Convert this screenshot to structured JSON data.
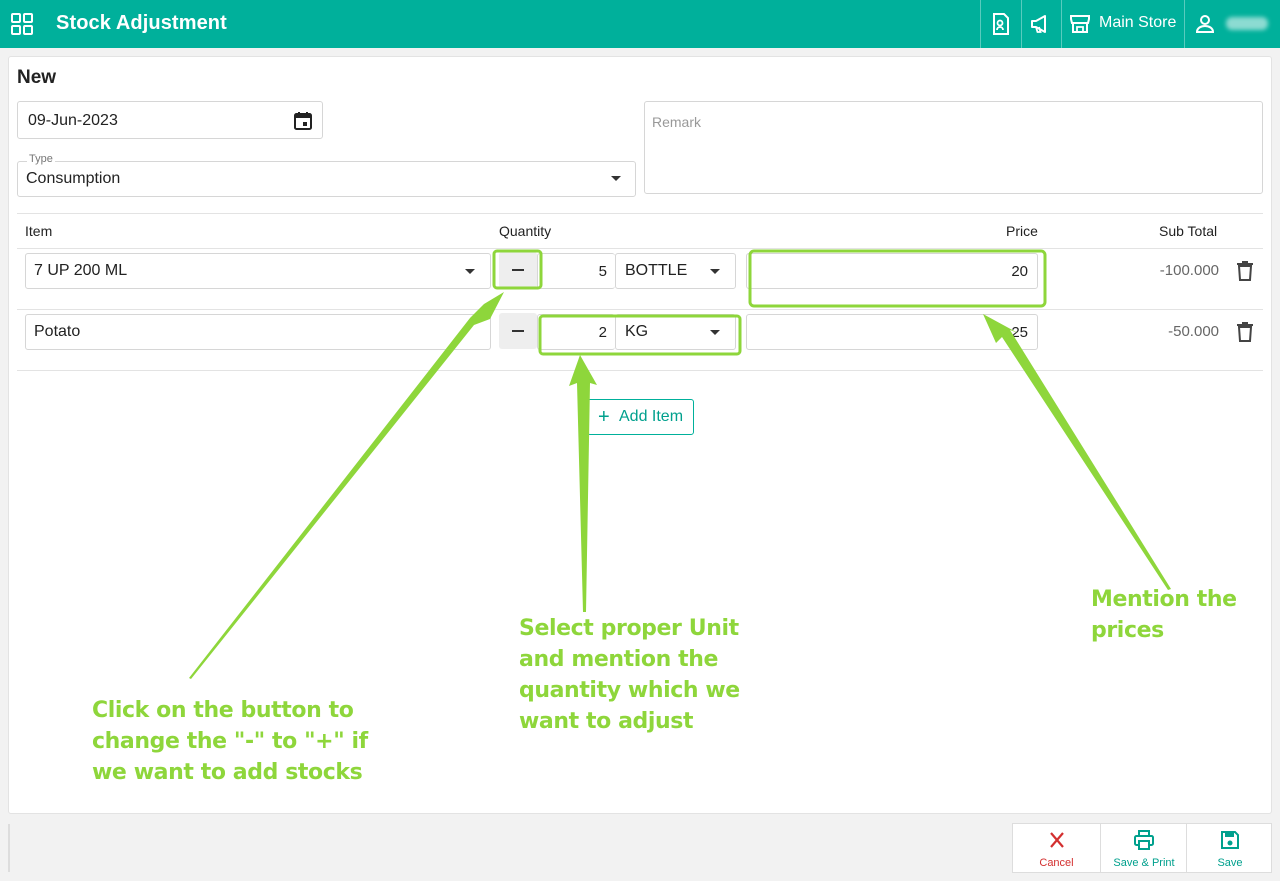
{
  "header": {
    "title": "Stock Adjustment",
    "store": "Main Store",
    "icons": [
      "apps-grid-icon",
      "report-icon",
      "megaphone-icon",
      "store-icon",
      "user-icon"
    ]
  },
  "form": {
    "heading": "New",
    "date": "09-Jun-2023",
    "type_label": "Type",
    "type_value": "Consumption",
    "remark_placeholder": "Remark"
  },
  "table": {
    "headers": {
      "item": "Item",
      "quantity": "Quantity",
      "price": "Price",
      "subtotal": "Sub Total"
    },
    "rows": [
      {
        "item": "7 UP 200 ML",
        "sign": "-",
        "qty": "5",
        "unit": "BOTTLE",
        "price": "20",
        "subtotal": "-100.000"
      },
      {
        "item": "Potato",
        "sign": "-",
        "qty": "2",
        "unit": "KG",
        "price": "25",
        "subtotal": "-50.000"
      }
    ]
  },
  "add_item_label": "Add Item",
  "footer": {
    "cancel": "Cancel",
    "save_print": "Save & Print",
    "save": "Save"
  },
  "annotations": {
    "sign_note": [
      "Click on the button to",
      "change the \"-\" to \"+\" if",
      "we want to add stocks"
    ],
    "unit_note": [
      "Select proper Unit",
      "and mention the",
      "quantity which we",
      "want to adjust"
    ],
    "price_note": [
      "Mention the",
      "prices"
    ]
  },
  "colors": {
    "primary": "#00b09b",
    "annotation": "#8ed63b",
    "cancel": "#d32f2f"
  }
}
